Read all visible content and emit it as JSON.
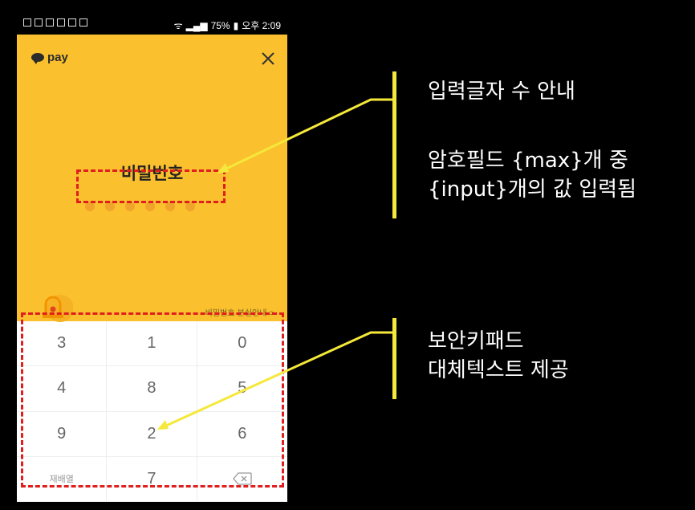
{
  "status_bar": {
    "battery": "75%",
    "time": "오후 2:09"
  },
  "header": {
    "logo_text": "pay",
    "close_icon": "close-icon"
  },
  "password": {
    "title": "비밀번호",
    "digit_count": 6,
    "lost_link": "비밀번호 분실안내 >"
  },
  "keypad": {
    "keys": [
      "3",
      "1",
      "0",
      "4",
      "8",
      "5",
      "9",
      "2",
      "6",
      "재배열",
      "7",
      "backspace"
    ]
  },
  "annotations": {
    "note1": "입력글자 수 안내",
    "note2_line1": "암호필드 {max}개 중",
    "note2_line2": "{input}개의 값 입력됨",
    "note3_line1": "보안키패드",
    "note3_line2": "대체텍스트 제공"
  },
  "colors": {
    "header_yellow": "#fbc02d",
    "dot": "#f0a42a",
    "annotation_red": "#e01e1e",
    "annotation_yellow": "#f5e83a"
  }
}
